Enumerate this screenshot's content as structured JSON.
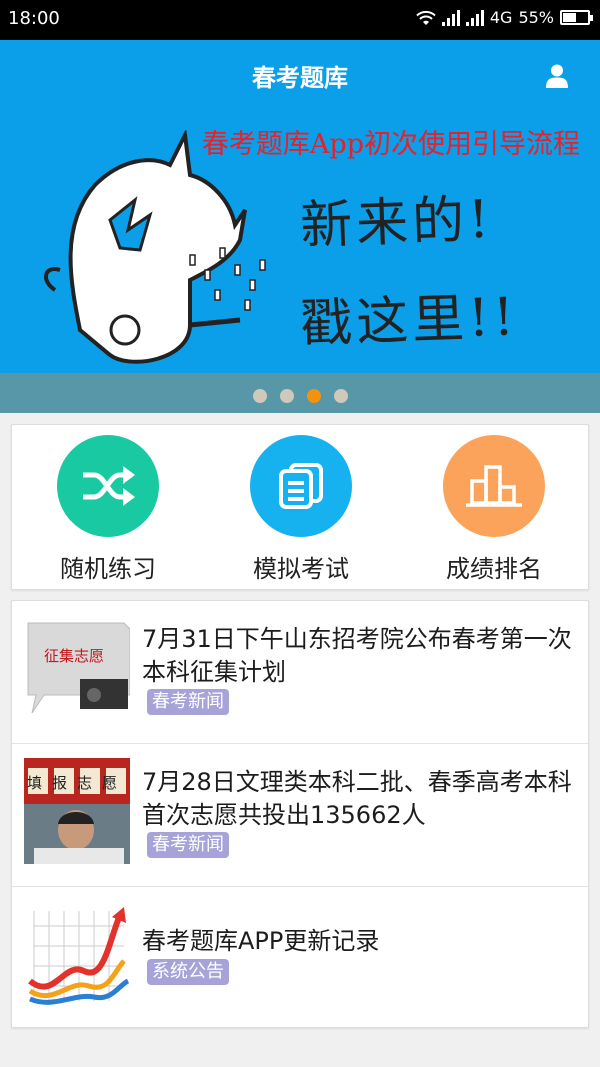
{
  "status_bar": {
    "time": "18:00",
    "network": "4G",
    "battery": "55%",
    "battery_level": 0.55
  },
  "app_bar": {
    "title": "春考题库",
    "user_icon": "user-icon"
  },
  "banner": {
    "caption": "春考题库App初次使用引导流程",
    "line1": "新来的!",
    "line2": "戳这里!!",
    "page_count": 4,
    "active_page": 3
  },
  "quick_actions": [
    {
      "label": "随机练习",
      "icon": "shuffle-icon",
      "color": "#19c9a2"
    },
    {
      "label": "模拟考试",
      "icon": "paper-stack-icon",
      "color": "#16b2ef"
    },
    {
      "label": "成绩排名",
      "icon": "ranking-icon",
      "color": "#fba35a"
    }
  ],
  "news": [
    {
      "title": "7月31日下午山东招考院公布春考第一次本科征集计划",
      "tag": "春考新闻",
      "thumb_text": "征集志愿"
    },
    {
      "title": "7月28日文理类本科二批、春季高考本科首次志愿共投出135662人",
      "tag": "春考新闻",
      "thumb_text": "填报志愿"
    },
    {
      "title": "春考题库APP更新记录",
      "tag": "系统公告"
    }
  ]
}
